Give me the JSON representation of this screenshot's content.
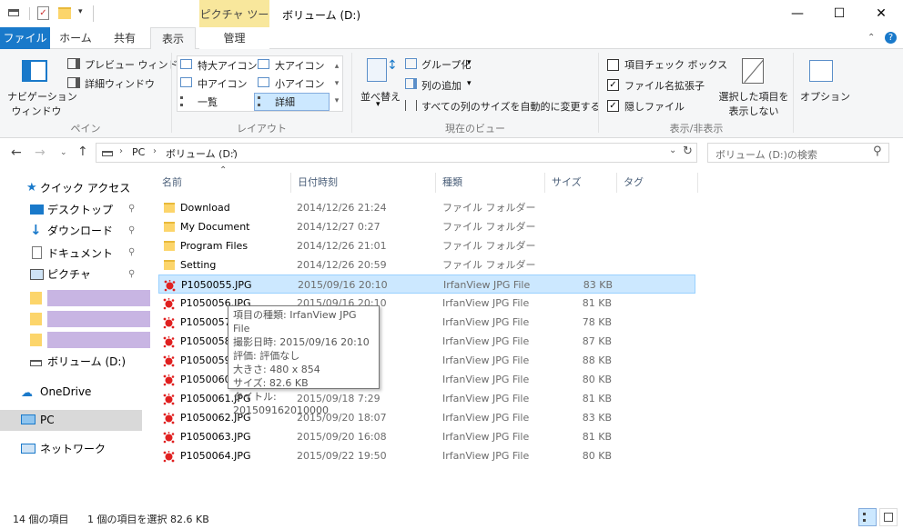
{
  "window": {
    "title": "ボリューム (D:)",
    "context_tab": "ピクチャ ツール"
  },
  "tabs": [
    {
      "label": "ファイル"
    },
    {
      "label": "ホーム"
    },
    {
      "label": "共有"
    },
    {
      "label": "表示"
    },
    {
      "label": "管理"
    }
  ],
  "ribbon": {
    "pane": {
      "nav_pane": "ナビゲーション\nウィンドウ",
      "nav_pane_l1": "ナビゲーション",
      "nav_pane_l2": "ウィンドウ",
      "preview": "プレビュー ウィンドウ",
      "details": "詳細ウィンドウ",
      "label": "ペイン"
    },
    "layout": {
      "xl_icons": "特大アイコン",
      "l_icons": "大アイコン",
      "m_icons": "中アイコン",
      "s_icons": "小アイコン",
      "list": "一覧",
      "details": "詳細",
      "label": "レイアウト"
    },
    "view": {
      "sort": "並べ替え",
      "group": "グループ化",
      "add_col": "列の追加",
      "fit_cols": "すべての列のサイズを自動的に変更する",
      "label": "現在のビュー"
    },
    "showhide": {
      "item_check": "項目チェック ボックス",
      "ext": "ファイル名拡張子",
      "hidden": "隠しファイル",
      "hide_sel_l1": "選択した項目を",
      "hide_sel_l2": "表示しない",
      "label": "表示/非表示"
    },
    "options": "オプション"
  },
  "address": {
    "pc": "PC",
    "vol": "ボリューム (D:)",
    "search_placeholder": "ボリューム (D:)の検索"
  },
  "nav": {
    "quick": "クイック アクセス",
    "desktop": "デスクトップ",
    "downloads": "ダウンロード",
    "documents": "ドキュメント",
    "pictures": "ピクチャ",
    "volume": "ボリューム (D:)",
    "onedrive": "OneDrive",
    "pc": "PC",
    "network": "ネットワーク"
  },
  "columns": {
    "name": "名前",
    "date": "日付時刻",
    "type": "種類",
    "size": "サイズ",
    "tag": "タグ"
  },
  "files": [
    {
      "name": "Download",
      "date": "2014/12/26 21:24",
      "type": "ファイル フォルダー",
      "size": "",
      "kind": "folder"
    },
    {
      "name": "My Document",
      "date": "2014/12/27 0:27",
      "type": "ファイル フォルダー",
      "size": "",
      "kind": "folder"
    },
    {
      "name": "Program Files",
      "date": "2014/12/26 21:01",
      "type": "ファイル フォルダー",
      "size": "",
      "kind": "folder"
    },
    {
      "name": "Setting",
      "date": "2014/12/26 20:59",
      "type": "ファイル フォルダー",
      "size": "",
      "kind": "folder"
    },
    {
      "name": "P1050055.JPG",
      "date": "2015/09/16 20:10",
      "type": "IrfanView JPG File",
      "size": "83 KB",
      "kind": "jpg"
    },
    {
      "name": "P1050056.JPG",
      "date": "2015/09/16 20:10",
      "type": "IrfanView JPG File",
      "size": "81 KB",
      "kind": "jpg"
    },
    {
      "name": "P1050057.JPG",
      "date": "",
      "type": "IrfanView JPG File",
      "size": "78 KB",
      "kind": "jpg"
    },
    {
      "name": "P1050058.JPG",
      "date": "",
      "type": "IrfanView JPG File",
      "size": "87 KB",
      "kind": "jpg"
    },
    {
      "name": "P1050059.JPG",
      "date": "",
      "type": "IrfanView JPG File",
      "size": "88 KB",
      "kind": "jpg"
    },
    {
      "name": "P1050060.JPG",
      "date": "",
      "type": "IrfanView JPG File",
      "size": "80 KB",
      "kind": "jpg"
    },
    {
      "name": "P1050061.JPG",
      "date": "2015/09/18 7:29",
      "type": "IrfanView JPG File",
      "size": "81 KB",
      "kind": "jpg"
    },
    {
      "name": "P1050062.JPG",
      "date": "2015/09/20 18:07",
      "type": "IrfanView JPG File",
      "size": "83 KB",
      "kind": "jpg"
    },
    {
      "name": "P1050063.JPG",
      "date": "2015/09/20 16:08",
      "type": "IrfanView JPG File",
      "size": "81 KB",
      "kind": "jpg"
    },
    {
      "name": "P1050064.JPG",
      "date": "2015/09/22 19:50",
      "type": "IrfanView JPG File",
      "size": "80 KB",
      "kind": "jpg"
    }
  ],
  "tooltip": {
    "l1": "項目の種類: IrfanView JPG File",
    "l2": "撮影日時: 2015/09/16 20:10",
    "l3": "評価: 評価なし",
    "l4": "大きさ: 480 x 854",
    "l5": "サイズ: 82.6 KB",
    "l6": "タイトル: 201509162010000"
  },
  "status": {
    "count": "14 個の項目",
    "selected": "1 個の項目を選択  82.6 KB"
  },
  "colors": {
    "accent": "#1979ca",
    "selection": "#cce8ff",
    "context_tab": "#f8e79c",
    "hidden_name": "#c8b5e3"
  }
}
